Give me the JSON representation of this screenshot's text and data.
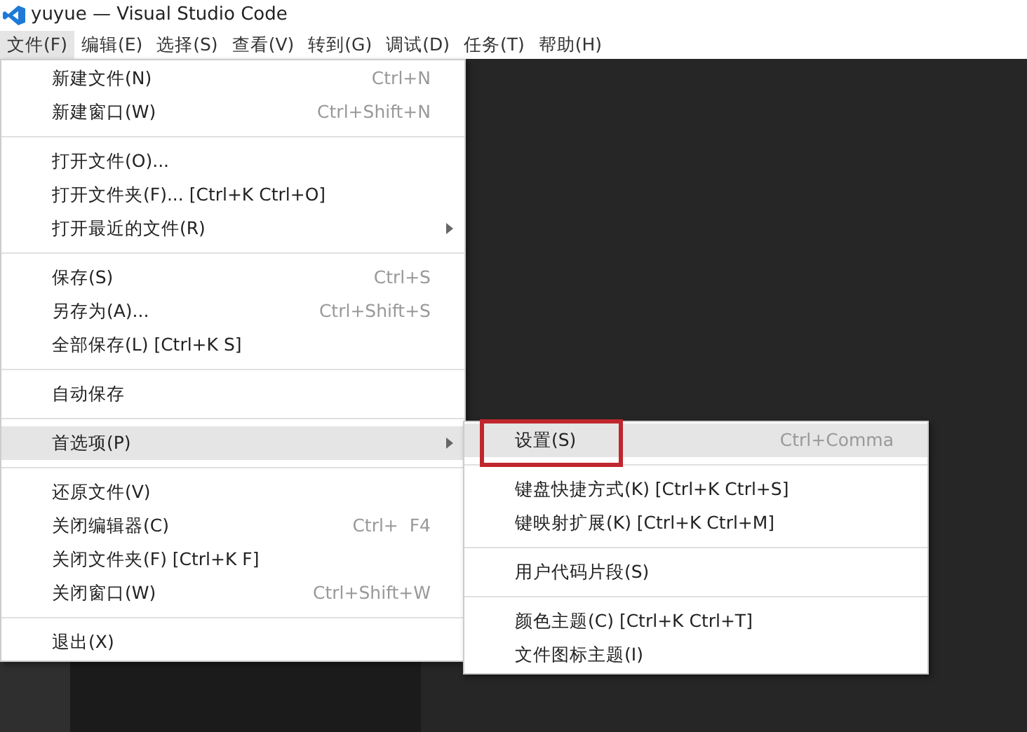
{
  "window": {
    "title": "yuyue — Visual Studio Code"
  },
  "menubar": [
    {
      "label": "文件(F)",
      "selected": true
    },
    {
      "label": "编辑(E)",
      "selected": false
    },
    {
      "label": "选择(S)",
      "selected": false
    },
    {
      "label": "查看(V)",
      "selected": false
    },
    {
      "label": "转到(G)",
      "selected": false
    },
    {
      "label": "调试(D)",
      "selected": false
    },
    {
      "label": "任务(T)",
      "selected": false
    },
    {
      "label": "帮助(H)",
      "selected": false
    }
  ],
  "file_menu": {
    "groups": [
      [
        {
          "label": "新建文件(N)",
          "shortcut": "Ctrl+N",
          "submenu": false,
          "selected": false
        },
        {
          "label": "新建窗口(W)",
          "shortcut": "Ctrl+Shift+N",
          "submenu": false,
          "selected": false
        }
      ],
      [
        {
          "label": "打开文件(O)...",
          "submenu": false,
          "selected": false
        },
        {
          "label": "打开文件夹(F)... [Ctrl+K Ctrl+O]",
          "submenu": false,
          "selected": false
        },
        {
          "label": "打开最近的文件(R)",
          "submenu": true,
          "selected": false
        }
      ],
      [
        {
          "label": "保存(S)",
          "shortcut": "Ctrl+S",
          "submenu": false,
          "selected": false
        },
        {
          "label": "另存为(A)...",
          "shortcut": "Ctrl+Shift+S",
          "submenu": false,
          "selected": false
        },
        {
          "label": "全部保存(L) [Ctrl+K S]",
          "submenu": false,
          "selected": false
        }
      ],
      [
        {
          "label": "自动保存",
          "submenu": false,
          "selected": false
        }
      ],
      [
        {
          "label": "首选项(P)",
          "submenu": true,
          "selected": true
        }
      ],
      [
        {
          "label": "还原文件(V)",
          "submenu": false,
          "selected": false
        },
        {
          "label": "关闭编辑器(C)",
          "shortcut": "Ctrl+  F4",
          "submenu": false,
          "selected": false
        },
        {
          "label": "关闭文件夹(F) [Ctrl+K F]",
          "submenu": false,
          "selected": false
        },
        {
          "label": "关闭窗口(W)",
          "shortcut": "Ctrl+Shift+W",
          "submenu": false,
          "selected": false
        }
      ],
      [
        {
          "label": "退出(X)",
          "submenu": false,
          "selected": false
        }
      ]
    ]
  },
  "preferences_submenu": {
    "groups": [
      [
        {
          "label": "设置(S)",
          "shortcut": "Ctrl+Comma",
          "selected": true,
          "annotated": true
        }
      ],
      [
        {
          "label": "键盘快捷方式(K) [Ctrl+K Ctrl+S]",
          "selected": false,
          "annotated": false
        },
        {
          "label": "键映射扩展(K) [Ctrl+K Ctrl+M]",
          "selected": false,
          "annotated": false
        }
      ],
      [
        {
          "label": "用户代码片段(S)",
          "selected": false,
          "annotated": false
        }
      ],
      [
        {
          "label": "颜色主题(C) [Ctrl+K Ctrl+T]",
          "selected": false,
          "annotated": false
        },
        {
          "label": "文件图标主题(I)",
          "selected": false,
          "annotated": false
        }
      ]
    ]
  }
}
